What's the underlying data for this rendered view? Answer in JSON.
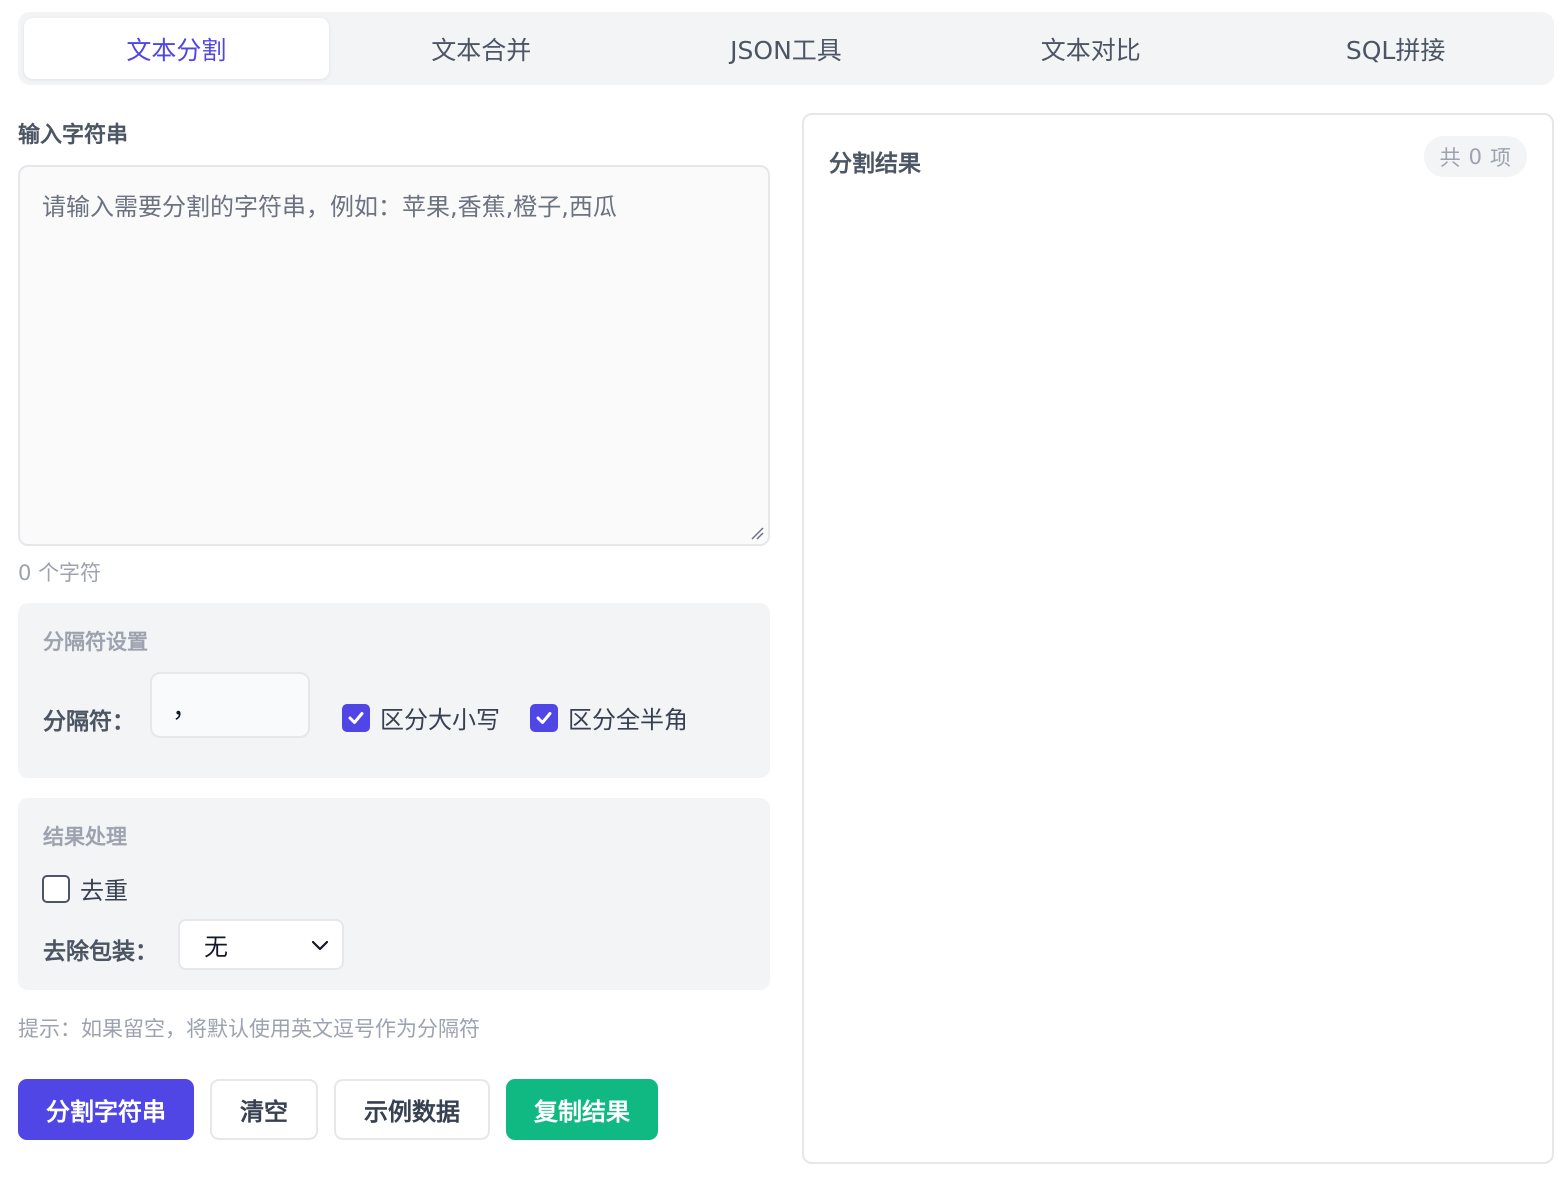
{
  "tabs": [
    {
      "label": "文本分割",
      "active": true
    },
    {
      "label": "文本合并",
      "active": false
    },
    {
      "label": "JSON工具",
      "active": false
    },
    {
      "label": "文本对比",
      "active": false
    },
    {
      "label": "SQL拼接",
      "active": false
    }
  ],
  "input": {
    "label": "输入字符串",
    "value": "",
    "placeholder": "请输入需要分割的字符串，例如：苹果,香蕉,橙子,西瓜",
    "char_count_value": "0",
    "char_count_unit": "个字符"
  },
  "separator_settings": {
    "title": "分隔符设置",
    "separator_label": "分隔符：",
    "separator_value": "，",
    "case_sensitive": {
      "label": "区分大小写",
      "checked": true
    },
    "width_sensitive": {
      "label": "区分全半角",
      "checked": true
    }
  },
  "result_processing": {
    "title": "结果处理",
    "dedupe": {
      "label": "去重",
      "checked": false
    },
    "unwrap_label": "去除包装：",
    "unwrap_selected": "无"
  },
  "hint": "提示：如果留空，将默认使用英文逗号作为分隔符",
  "buttons": {
    "split": "分割字符串",
    "clear": "清空",
    "sample": "示例数据",
    "copy": "复制结果"
  },
  "result_panel": {
    "title": "分割结果",
    "count_prefix": "共",
    "count": "0",
    "count_suffix": "项"
  },
  "colors": {
    "primary": "#4f46e5",
    "success": "#10b981",
    "panel_bg": "#f3f4f6"
  },
  "icons": {
    "checkbox_checked": "check-icon",
    "select_arrow": "chevron-down-icon",
    "resize": "resize-grip-icon"
  }
}
